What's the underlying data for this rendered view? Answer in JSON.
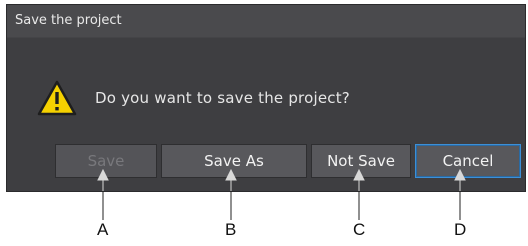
{
  "dialog": {
    "title": "Save the project",
    "message": "Do you want to save the project?"
  },
  "buttons": {
    "save": "Save",
    "save_as": "Save As",
    "not_save": "Not Save",
    "cancel": "Cancel"
  },
  "callouts": [
    "A",
    "B",
    "C",
    "D"
  ],
  "icons": {
    "warning": "warning-triangle-icon"
  },
  "colors": {
    "dialog_bg": "#444447",
    "accent": "#3d8fd6",
    "warning": "#f5d100"
  }
}
